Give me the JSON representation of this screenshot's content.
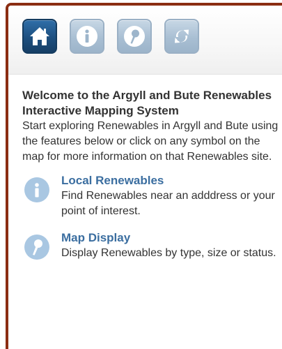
{
  "toolbar": {
    "buttons": [
      {
        "name": "home",
        "icon": "home-icon",
        "active": true
      },
      {
        "name": "info",
        "icon": "info-icon",
        "active": false
      },
      {
        "name": "map-display",
        "icon": "map-pin-icon",
        "active": false
      },
      {
        "name": "refresh",
        "icon": "refresh-icon",
        "active": false
      }
    ]
  },
  "welcome": {
    "title": "Welcome to the Argyll and Bute Renewables Interactive Mapping System",
    "text": "Start exploring Renewables in Argyll and Bute using the features below or click on any symbol on the map for more information on that Renewables site."
  },
  "features": [
    {
      "icon": "info-icon",
      "title": "Local Renewables",
      "description": "Find Renewables near an adddress or your point of interest."
    },
    {
      "icon": "map-pin-icon",
      "title": "Map Display",
      "description": "Display Renewables by type, size or status."
    }
  ],
  "colors": {
    "frame_border": "#8b2d12",
    "active_button": "#1d4f7f",
    "inactive_button": "#a9bfd3",
    "feature_title": "#3b6ea0",
    "feature_icon": "#a9c7e2",
    "body_text": "#333333"
  }
}
